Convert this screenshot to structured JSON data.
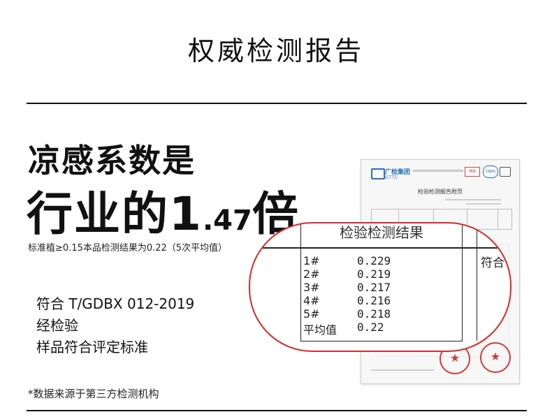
{
  "title": "权威检测报告",
  "headline": {
    "line1": "凉感系数是",
    "line2_prefix": "行业的1",
    "line2_dot": ".",
    "line2_digits": "47",
    "line2_suffix": "倍"
  },
  "note": "标准植≥0.15本品检测结果为0.22（5次平均值）",
  "standard_lines": [
    "符合 T/GDBX 012-2019",
    "经检验",
    "样品符合评定标准"
  ],
  "footnote": "*数据来源于第三方检测机构",
  "report": {
    "brand": "广检集团",
    "brand_sub": "GTTC",
    "cert_mark": "MA",
    "cnas_mark": "CNAS",
    "doc_title": "检验检测报告附页"
  },
  "callout": {
    "section_header": "检验检测结果",
    "rows": [
      {
        "label": "1#",
        "value": "0.229"
      },
      {
        "label": "2#",
        "value": "0.219"
      },
      {
        "label": "3#",
        "value": "0.217"
      },
      {
        "label": "4#",
        "value": "0.216"
      },
      {
        "label": "5#",
        "value": "0.218"
      },
      {
        "label": "平均值",
        "value": "0.22"
      }
    ],
    "result": "符合"
  },
  "colors": {
    "accent_red": "#d52b2b",
    "brand_blue": "#2a6fb4",
    "text": "#111111"
  }
}
